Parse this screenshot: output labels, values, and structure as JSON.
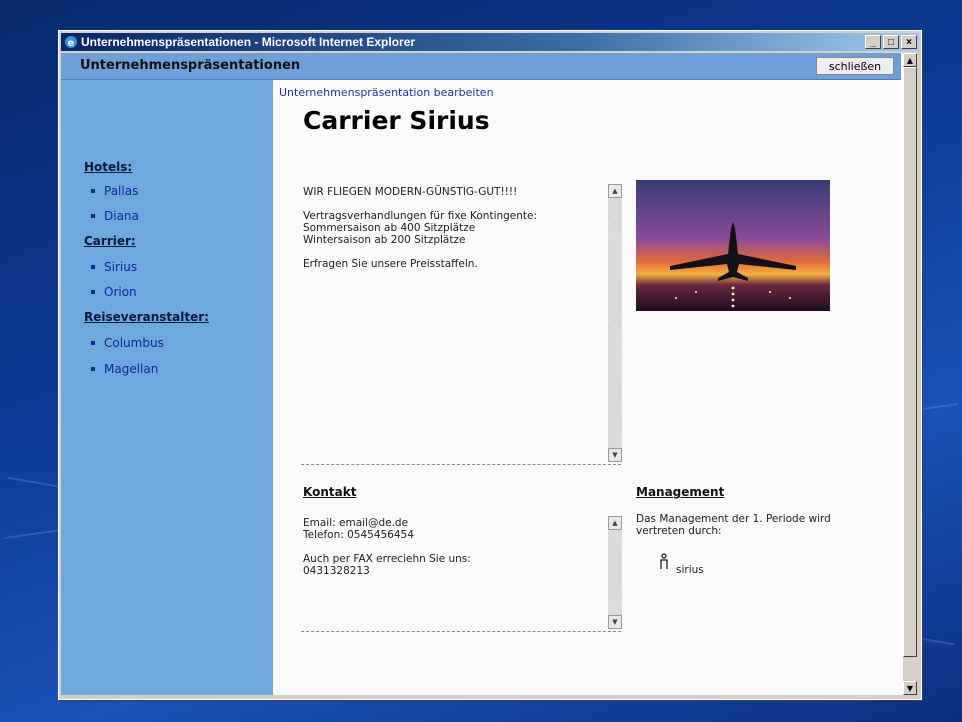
{
  "window": {
    "title": "Unternehmenspräsentationen - Microsoft Internet Explorer",
    "minimize": "_",
    "maximize": "□",
    "close": "×"
  },
  "app": {
    "header_title": "Unternehmenspräsentationen",
    "close_label": "schließen"
  },
  "sidebar": {
    "groups": [
      {
        "label": "Hotels:",
        "items": [
          "Pallas",
          "Diana"
        ]
      },
      {
        "label": "Carrier:",
        "items": [
          "Sirius",
          "Orion"
        ]
      },
      {
        "label": "Reiseveranstalter:",
        "items": [
          "Columbus",
          "Magellan"
        ]
      }
    ]
  },
  "main": {
    "edit_link": "Unternehmenspräsentation bearbeiten",
    "title": "Carrier Sirius",
    "description": "WIR FLIEGEN MODERN-GÜNSTIG-GUT!!!!\n\nVertragsverhandlungen für fixe Kontingente:\nSommersaison ab 400 Sitzplätze\nWintersaison ab 200 Sitzplätze\n\nErfragen Sie unsere Preisstaffeln.",
    "contact_heading": "Kontakt",
    "contact_text": "Email: email@de.de\nTelefon: 0545456454\n\nAuch per FAX erreciehn Sie uns:\n0431328213",
    "management_heading": "Management",
    "management_text": "Das Management der 1. Periode wird\nvertreten durch:",
    "manager_name": "sirius"
  },
  "colors": {
    "sidebar_bg": "#6ea8dc",
    "header_bg": "#6f9fd8",
    "link": "#0a2a9a"
  }
}
